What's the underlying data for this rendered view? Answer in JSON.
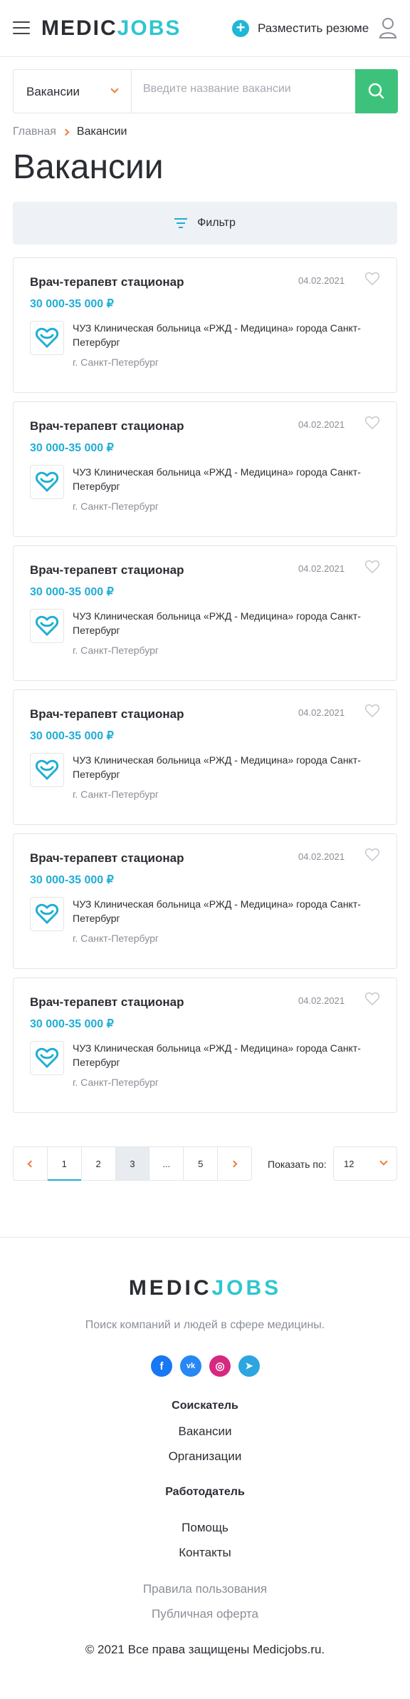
{
  "header": {
    "logo_part1": "MEDIC",
    "logo_part2": "JOBS",
    "post_resume_label": "Разместить резюме",
    "plus_symbol": "+"
  },
  "search": {
    "category": "Вакансии",
    "placeholder": "Введите название вакансии"
  },
  "breadcrumb": {
    "home": "Главная",
    "current": "Вакансии"
  },
  "page_title": "Вакансии",
  "filter_label": "Фильтр",
  "vacancies": [
    {
      "title": "Врач-терапевт стационар",
      "date": "04.02.2021",
      "salary": "30 000-35 000 ₽",
      "org": "ЧУЗ Клиническая больница «РЖД - Медицина» города Санкт-Петербург",
      "city": "г. Санкт-Петербург"
    },
    {
      "title": "Врач-терапевт стационар",
      "date": "04.02.2021",
      "salary": "30 000-35 000 ₽",
      "org": "ЧУЗ Клиническая больница «РЖД - Медицина» города Санкт-Петербург",
      "city": "г. Санкт-Петербург"
    },
    {
      "title": "Врач-терапевт стационар",
      "date": "04.02.2021",
      "salary": "30 000-35 000 ₽",
      "org": "ЧУЗ Клиническая больница «РЖД - Медицина» города Санкт-Петербург",
      "city": "г. Санкт-Петербург"
    },
    {
      "title": "Врач-терапевт стационар",
      "date": "04.02.2021",
      "salary": "30 000-35 000 ₽",
      "org": "ЧУЗ Клиническая больница «РЖД - Медицина» города Санкт-Петербург",
      "city": "г. Санкт-Петербург"
    },
    {
      "title": "Врач-терапевт стационар",
      "date": "04.02.2021",
      "salary": "30 000-35 000 ₽",
      "org": "ЧУЗ Клиническая больница «РЖД - Медицина» города Санкт-Петербург",
      "city": "г. Санкт-Петербург"
    },
    {
      "title": "Врач-терапевт стационар",
      "date": "04.02.2021",
      "salary": "30 000-35 000 ₽",
      "org": "ЧУЗ Клиническая больница «РЖД - Медицина» города Санкт-Петербург",
      "city": "г. Санкт-Петербург"
    }
  ],
  "pagination": {
    "pages": [
      "1",
      "2",
      "3",
      "...",
      "5"
    ],
    "active_page": "1",
    "current_page": "3",
    "show_label": "Показать по:",
    "per_page": "12"
  },
  "footer": {
    "logo_part1": "MEDIC",
    "logo_part2": "JOBS",
    "tagline": "Поиск компаний и людей в сфере медицины.",
    "socials": [
      {
        "name": "facebook-icon",
        "glyph": "f",
        "color": "#1877f2"
      },
      {
        "name": "vk-icon",
        "glyph": "vk",
        "color": "#2787f5"
      },
      {
        "name": "instagram-icon",
        "glyph": "◎",
        "color": "#d6297f"
      },
      {
        "name": "telegram-icon",
        "glyph": "➤",
        "color": "#2ca5e0"
      }
    ],
    "seeker_heading": "Соискатель",
    "seeker_links": [
      "Вакансии",
      "Организации"
    ],
    "employer_heading": "Работодатель",
    "employer_links": [
      "Помощь",
      "Контакты"
    ],
    "terms": "Правила пользования",
    "offer": "Публичная оферта",
    "copyright": "© 2021 Все права защищены Medicjobs.ru."
  },
  "colors": {
    "accent_blue": "#1faed5",
    "logo_teal": "#2fc6d0",
    "search_green": "#3dc27c",
    "arrow_orange": "#f07a3a"
  }
}
